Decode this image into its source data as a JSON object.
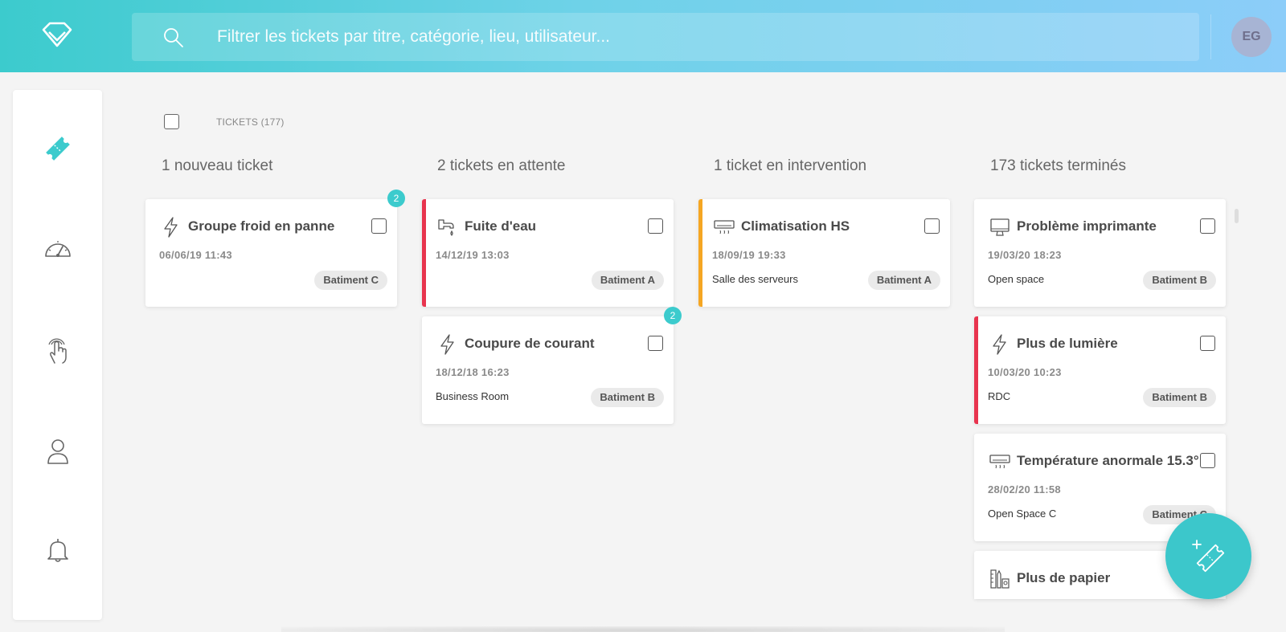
{
  "search": {
    "placeholder": "Filtrer les tickets par titre, catégorie, lieu, utilisateur..."
  },
  "user": {
    "initials": "EG"
  },
  "sidebar": {
    "items": [
      {
        "icon": "ticket-icon",
        "active": true
      },
      {
        "icon": "dashboard-gauge-icon",
        "active": false
      },
      {
        "icon": "touch-hand-icon",
        "active": false
      },
      {
        "icon": "user-icon",
        "active": false
      },
      {
        "icon": "bell-icon",
        "active": false
      }
    ]
  },
  "header": {
    "tickets_label": "TICKETS (177)"
  },
  "columns": [
    {
      "title": "1 nouveau ticket",
      "cards": [
        {
          "icon": "lightning-icon",
          "title": "Groupe froid en panne",
          "date": "06/06/19 11:43",
          "place": "",
          "tag": "Batiment C",
          "badge": "2",
          "stripe": ""
        }
      ]
    },
    {
      "title": "2 tickets en attente",
      "cards": [
        {
          "icon": "faucet-icon",
          "title": "Fuite d'eau",
          "date": "14/12/19 13:03",
          "place": "",
          "tag": "Batiment A",
          "badge": "",
          "stripe": "#e8344e"
        },
        {
          "icon": "lightning-icon",
          "title": "Coupure de courant",
          "date": "18/12/18 16:23",
          "place": "Business Room",
          "tag": "Batiment B",
          "badge": "2",
          "stripe": ""
        }
      ]
    },
    {
      "title": "1 ticket en intervention",
      "cards": [
        {
          "icon": "air-conditioner-icon",
          "title": "Climatisation HS",
          "date": "18/09/19 19:33",
          "place": "Salle des serveurs",
          "tag": "Batiment A",
          "badge": "",
          "stripe": "#f5a623"
        }
      ]
    },
    {
      "title": "173 tickets terminés",
      "cards": [
        {
          "icon": "computer-icon",
          "title": "Problème imprimante",
          "date": "19/03/20 18:23",
          "place": "Open space",
          "tag": "Batiment B",
          "badge": "",
          "stripe": ""
        },
        {
          "icon": "lightning-icon",
          "title": "Plus de lumière",
          "date": "10/03/20 10:23",
          "place": "RDC",
          "tag": "Batiment B",
          "badge": "",
          "stripe": "#e8344e"
        },
        {
          "icon": "air-conditioner-icon",
          "title": "Température anormale 15.3°",
          "date": "28/02/20 11:58",
          "place": "Open Space C",
          "tag": "Batiment C",
          "badge": "",
          "stripe": ""
        },
        {
          "icon": "office-supplies-icon",
          "title": "Plus de papier",
          "date": "",
          "place": "",
          "tag": "",
          "badge": "",
          "stripe": ""
        }
      ]
    }
  ],
  "colors": {
    "accent": "#3ccbcd",
    "urgent": "#e8344e",
    "warning": "#f5a623"
  }
}
